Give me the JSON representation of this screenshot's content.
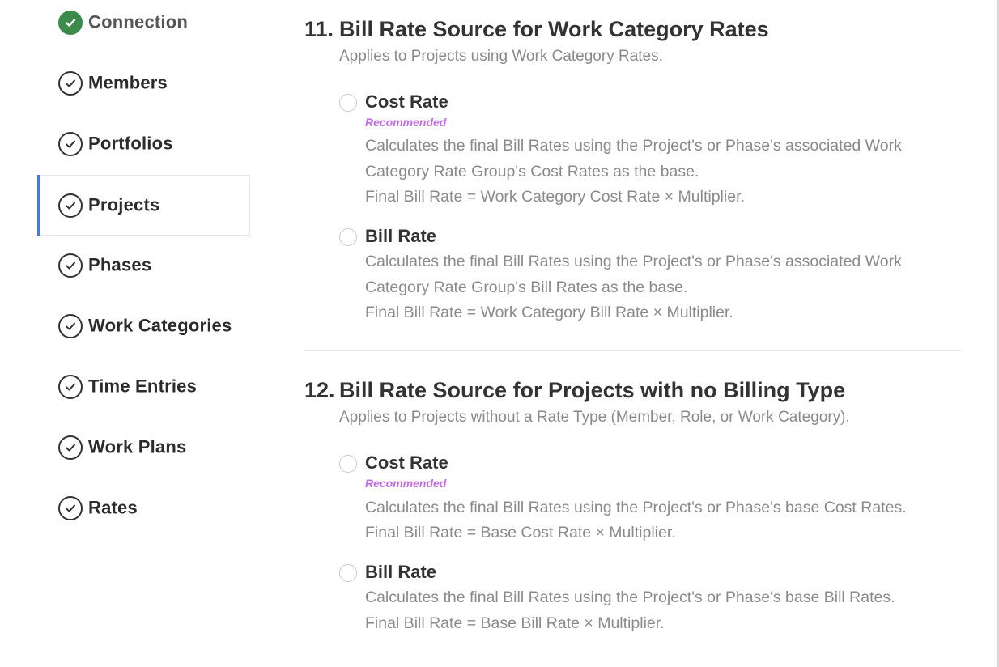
{
  "sidebar": {
    "items": [
      {
        "label": "Connection",
        "icon": "check-circle-filled-icon"
      },
      {
        "label": "Members",
        "icon": "check-circle-icon"
      },
      {
        "label": "Portfolios",
        "icon": "check-circle-icon"
      },
      {
        "label": "Projects",
        "icon": "check-circle-icon",
        "active": true
      },
      {
        "label": "Phases",
        "icon": "check-circle-icon"
      },
      {
        "label": "Work Categories",
        "icon": "check-circle-icon"
      },
      {
        "label": "Time Entries",
        "icon": "check-circle-icon"
      },
      {
        "label": "Work Plans",
        "icon": "check-circle-icon"
      },
      {
        "label": "Rates",
        "icon": "check-circle-icon"
      }
    ]
  },
  "sections": [
    {
      "number": "11.",
      "title": "Bill Rate Source for Work Category Rates",
      "subtitle": "Applies to Projects using Work Category Rates.",
      "options": [
        {
          "label": "Cost Rate",
          "badge": "Recommended",
          "desc_line1": "Calculates the final Bill Rates using the Project's or Phase's associated Work",
          "desc_line2": "Category Rate Group's Cost Rates as the base.",
          "formula": "Final Bill Rate = Work Category Cost Rate × Multiplier."
        },
        {
          "label": "Bill Rate",
          "desc_line1": "Calculates the final Bill Rates using the Project's or Phase's associated Work",
          "desc_line2": "Category Rate Group's Bill Rates as the base.",
          "formula": "Final Bill Rate = Work Category Bill Rate × Multiplier."
        }
      ]
    },
    {
      "number": "12.",
      "title": "Bill Rate Source for Projects with no Billing Type",
      "subtitle": "Applies to Projects without a Rate Type (Member, Role, or Work Category).",
      "options": [
        {
          "label": "Cost Rate",
          "badge": "Recommended",
          "desc_line1": "Calculates the final Bill Rates using the Project's or Phase's base Cost Rates.",
          "formula": "Final Bill Rate = Base Cost Rate × Multiplier."
        },
        {
          "label": "Bill Rate",
          "desc_line1": "Calculates the final Bill Rates using the Project's or Phase's base Bill Rates.",
          "formula": "Final Bill Rate = Base Bill Rate × Multiplier."
        }
      ]
    }
  ],
  "colors": {
    "accent": "#4a7bd4",
    "done": "#3c8a4c",
    "recommended": "#c36be8",
    "muted_text": "#8a8a8a"
  }
}
